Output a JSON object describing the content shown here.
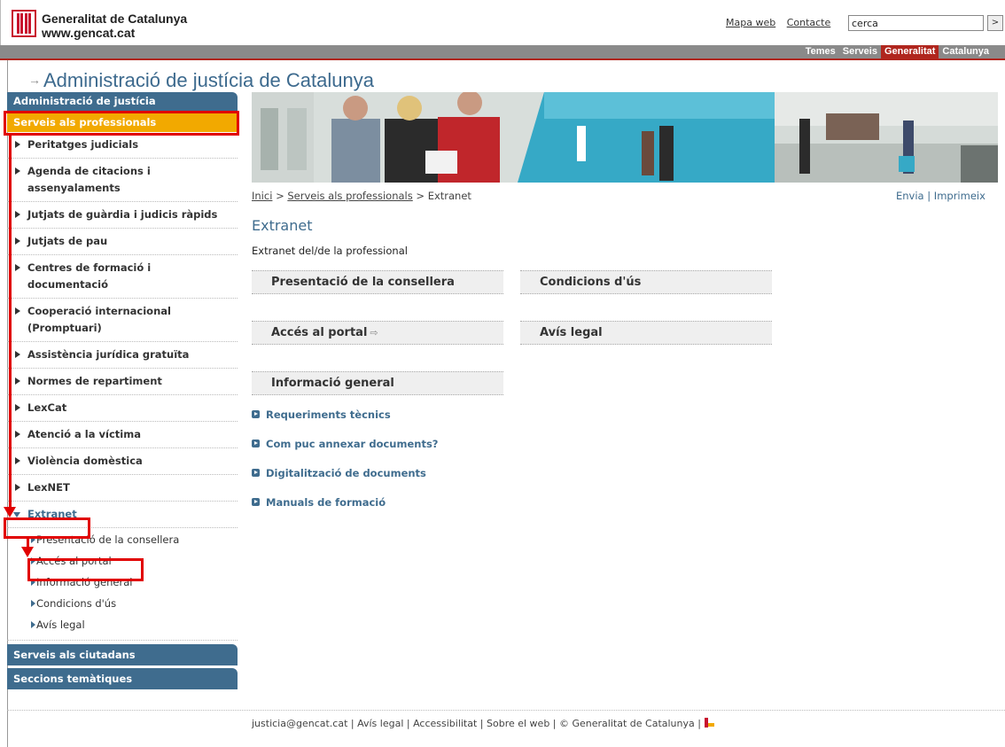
{
  "header": {
    "org_name": "Generalitat de Catalunya",
    "org_url": "www.gencat.cat",
    "links": [
      "Mapa web",
      "Contacte"
    ],
    "search_value": "cerca",
    "search_go": ">"
  },
  "nav": {
    "tabs": [
      {
        "label": "Temes",
        "active": false
      },
      {
        "label": "Serveis",
        "active": false
      },
      {
        "label": "Generalitat",
        "active": true
      },
      {
        "label": "Catalunya",
        "active": false
      }
    ]
  },
  "site_title": "Administració de justícia de Catalunya",
  "sidebar": {
    "section_title": "Administració de justícia",
    "active_section": "Serveis als professionals",
    "items": [
      "Peritatges judicials",
      "Agenda de citacions i assenyalaments",
      "Jutjats de guàrdia i judicis ràpids",
      "Jutjats de pau",
      "Centres de formació i documentació",
      "Cooperació internacional (Promptuari)",
      "Assistència jurídica gratuïta",
      "Normes de repartiment",
      "LexCat",
      "Atenció a la víctima",
      "Violència domèstica",
      "LexNET"
    ],
    "open_item": "Extranet",
    "subitems": [
      "Presentació de la consellera",
      "Accés al portal",
      "Informació general",
      "Condicions d'ús",
      "Avís legal"
    ],
    "footer_sections": [
      "Serveis als ciutadans",
      "Seccions temàtiques"
    ]
  },
  "breadcrumb": {
    "home": "Inici",
    "sep": ">",
    "parent": "Serveis als professionals",
    "current": "Extranet"
  },
  "page_tools": {
    "send": "Envia",
    "sep": "|",
    "print": "Imprimeix"
  },
  "main": {
    "title": "Extranet",
    "subtitle": "Extranet del/de la professional",
    "boxes": {
      "presentation": "Presentació de la consellera",
      "conditions": "Condicions d'ús",
      "access": "Accés al portal",
      "external_marker": "⇨",
      "legal": "Avís legal",
      "general": "Informació general"
    },
    "links": [
      "Requeriments tècnics",
      "Com puc annexar documents?",
      "Digitalització de documents",
      "Manuals de formació"
    ]
  },
  "footer": {
    "text": "justicia@gencat.cat | Avís legal | Accessibilitat | Sobre el web | © Generalitat de Catalunya |"
  },
  "colors": {
    "primary_blue": "#3f6c8e",
    "active_orange": "#f2a900",
    "brand_red": "#b0261e",
    "annotation_red": "#e10000",
    "nav_gray": "#8a8a8a"
  }
}
